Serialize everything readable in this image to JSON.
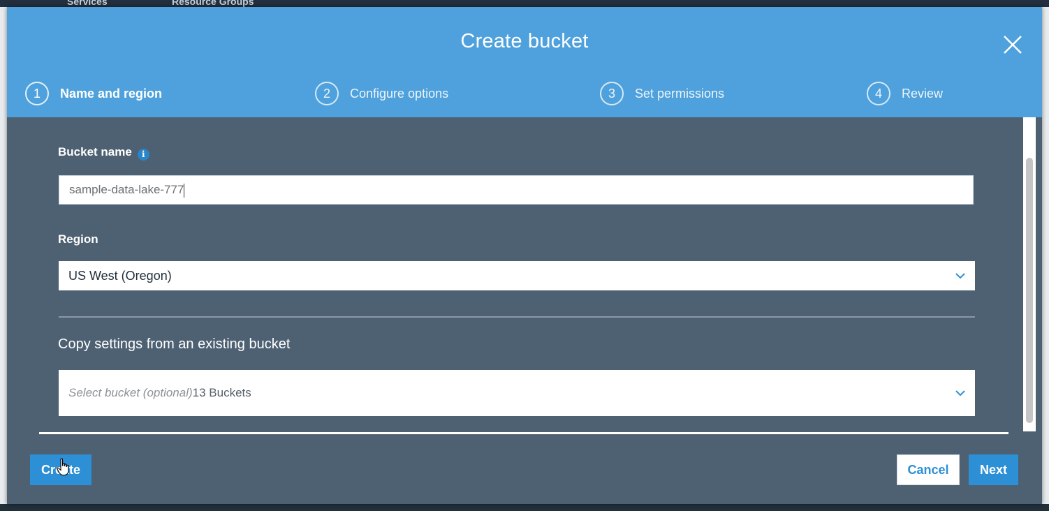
{
  "background": {
    "nav_items": [
      "Services",
      "Resource Groups"
    ]
  },
  "modal": {
    "title": "Create bucket",
    "steps": [
      {
        "number": "1",
        "label": "Name and region",
        "active": true
      },
      {
        "number": "2",
        "label": "Configure options",
        "active": false
      },
      {
        "number": "3",
        "label": "Set permissions",
        "active": false
      },
      {
        "number": "4",
        "label": "Review",
        "active": false
      }
    ],
    "bucket_name": {
      "label": "Bucket name",
      "value": "sample-data-lake-777"
    },
    "region": {
      "label": "Region",
      "selected": "US West (Oregon)"
    },
    "copy_settings": {
      "title": "Copy settings from an existing bucket",
      "placeholder": "Select bucket (optional)",
      "count": "13 Buckets"
    },
    "buttons": {
      "create": "Create",
      "cancel": "Cancel",
      "next": "Next"
    }
  },
  "colors": {
    "header": "#4ea1dc",
    "body": "#4e6173",
    "primary_button": "#2d8fd5"
  }
}
